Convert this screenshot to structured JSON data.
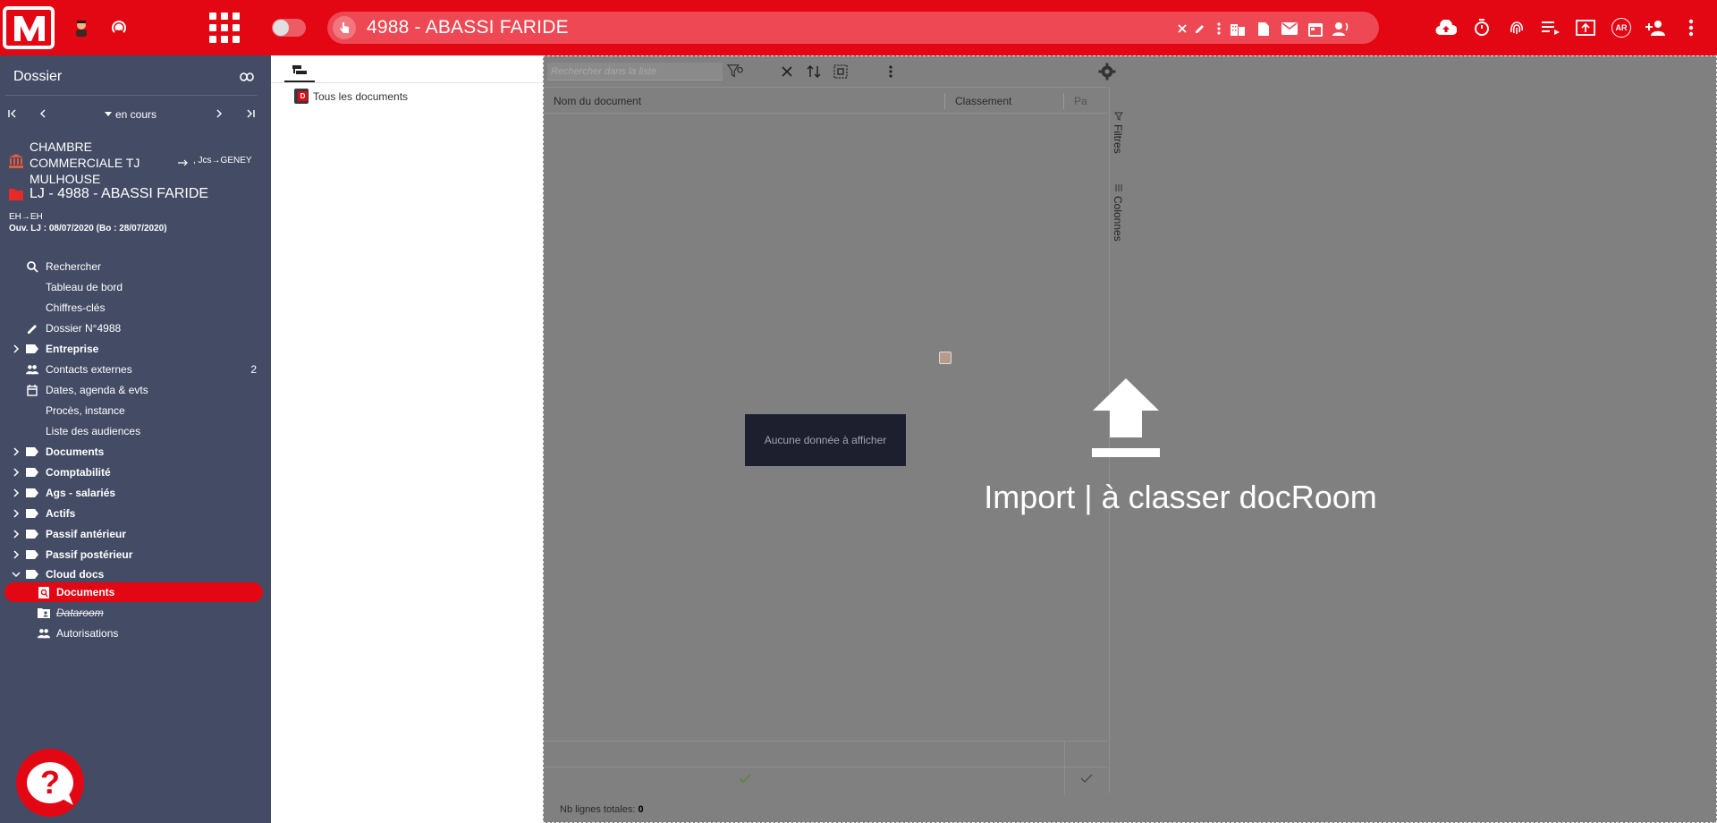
{
  "topbar": {
    "title": "4988 - ABASSI FARIDE",
    "avatar_label": "AR"
  },
  "sidebar": {
    "header": "Dossier",
    "status": "en cours",
    "court": "CHAMBRE COMMERCIALE TJ MULHOUSE",
    "court_ref": ", Jcs→GENEY",
    "case_title": "LJ - 4988 - ABASSI FARIDE",
    "case_sub": "EH→EH",
    "case_dates": "Ouv. LJ : 08/07/2020 (Bo : 28/07/2020)",
    "items": [
      {
        "label": "Rechercher"
      },
      {
        "label": "Tableau de bord"
      },
      {
        "label": "Chiffres-clés"
      },
      {
        "label": "Dossier N°4988"
      },
      {
        "label": "Entreprise"
      },
      {
        "label": "Contacts externes",
        "count": "2"
      },
      {
        "label": "Dates, agenda & evts"
      },
      {
        "label": "Procès, instance"
      },
      {
        "label": "Liste des audiences"
      },
      {
        "label": "Documents"
      },
      {
        "label": "Comptabilité"
      },
      {
        "label": "Ags - salariés"
      },
      {
        "label": "Actifs"
      },
      {
        "label": "Passif antérieur"
      },
      {
        "label": "Passif postérieur"
      },
      {
        "label": "Cloud docs"
      },
      {
        "label": "Documents"
      },
      {
        "label": "Dataroom"
      },
      {
        "label": "Autorisations"
      }
    ]
  },
  "tree": {
    "root_label": "Tous les documents"
  },
  "doclist": {
    "search_placeholder": "Rechercher dans la liste",
    "columns": [
      "Nom du document",
      "Classement",
      "Pa"
    ],
    "side_tabs": [
      "Filtres",
      "Colonnes"
    ],
    "empty_message": "Aucune donnée à afficher",
    "totals_label": "Nb lignes totales:",
    "totals_value": "0"
  },
  "dropzone": {
    "label": "Import | à classer docRoom"
  },
  "colors": {
    "brand": "#e30613",
    "sidebar": "#444c65",
    "overlay": "#808080"
  }
}
